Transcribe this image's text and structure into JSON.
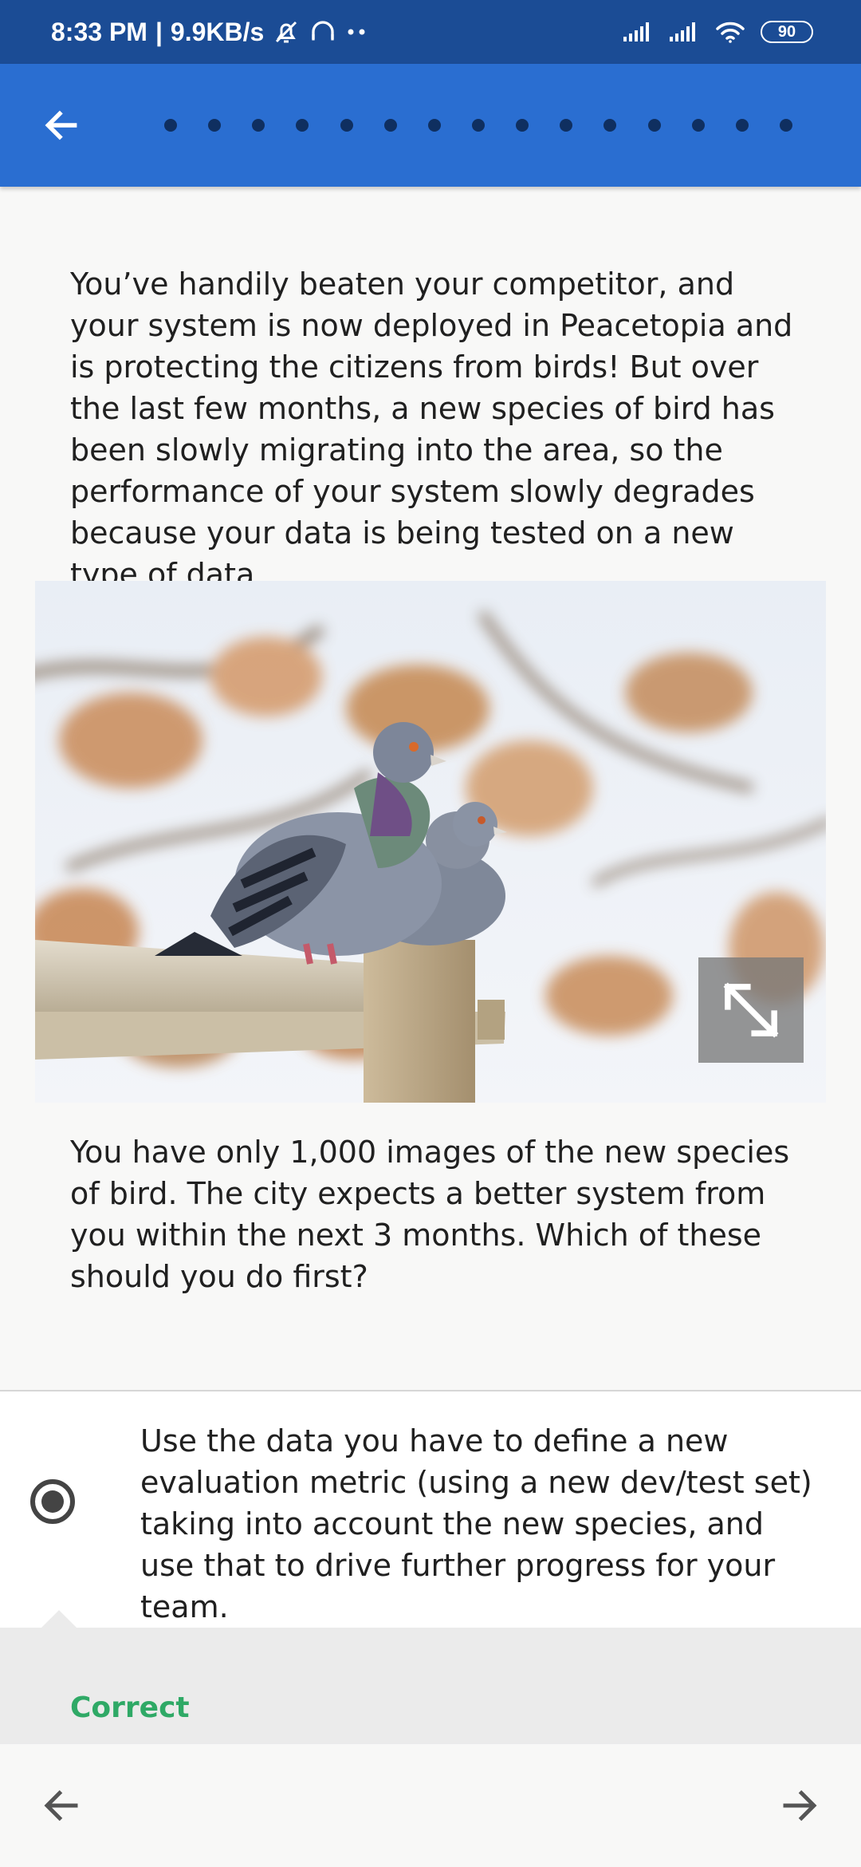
{
  "status_bar": {
    "time": "8:33 PM",
    "separator": "|",
    "network_speed": "9.9KB/s",
    "battery_level": "90",
    "icons": [
      "notification-off-icon",
      "headphones-icon",
      "more-dots-icon",
      "signal-icon",
      "signal-icon",
      "wifi-icon",
      "battery-icon"
    ]
  },
  "app_bar": {
    "back_icon": "arrow-left-icon",
    "progress_dots_count": 15
  },
  "question": {
    "paragraph_1": "You’ve handily beaten your competitor, and your system is now deployed in Peacetopia and is protecting the citizens from birds! But over the last few months, a new species of bird has been slowly migrating into the area, so the performance of your system slowly degrades because your data is being tested on a new type of data.",
    "image_icon": "expand-icon",
    "paragraph_2": "You have only 1,000 images of the new species of bird. The city expects a better system from you within the next 3 months. Which of these should you do first?"
  },
  "answer": {
    "selected": true,
    "text": "Use the data you have to define a new evaluation metric (using a new dev/test set) taking into account the new species, and use that to drive further progress for your team."
  },
  "feedback": {
    "label": "Correct",
    "color": "#2fa966"
  },
  "bottom_nav": {
    "prev_icon": "arrow-left-icon",
    "next_icon": "arrow-right-icon"
  },
  "colors": {
    "status_bar": "#1b4c95",
    "app_bar": "#2a6ed1",
    "dot": "#0f2f60"
  }
}
